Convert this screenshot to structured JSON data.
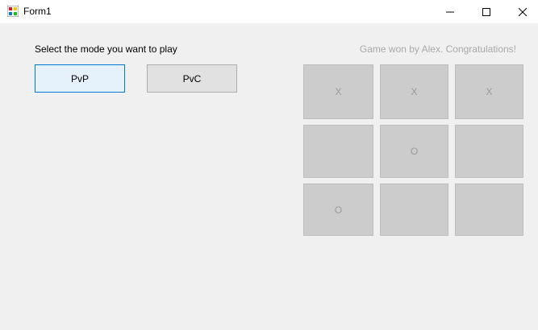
{
  "window": {
    "title": "Form1",
    "icon": "winforms-app-icon",
    "controls": {
      "minimize_icon": "minimize-icon",
      "maximize_icon": "maximize-icon",
      "close_icon": "close-icon"
    }
  },
  "mode_select": {
    "prompt": "Select the mode you want to play",
    "pvp_label": "PvP",
    "pvc_label": "PvC",
    "selected": "PvP"
  },
  "status": {
    "message": "Game won by Alex. Congratulations!"
  },
  "board": {
    "cells": [
      {
        "mark": "X"
      },
      {
        "mark": "X"
      },
      {
        "mark": "X"
      },
      {
        "mark": ""
      },
      {
        "mark": "O"
      },
      {
        "mark": ""
      },
      {
        "mark": "O"
      },
      {
        "mark": ""
      },
      {
        "mark": ""
      }
    ]
  },
  "colors": {
    "window_background": "#f0f0f0",
    "titlebar_background": "#ffffff",
    "selected_button_border": "#0078d7",
    "selected_button_fill": "#e5f1fb",
    "cell_fill": "#cccccc",
    "disabled_text": "#a9a9a9"
  }
}
